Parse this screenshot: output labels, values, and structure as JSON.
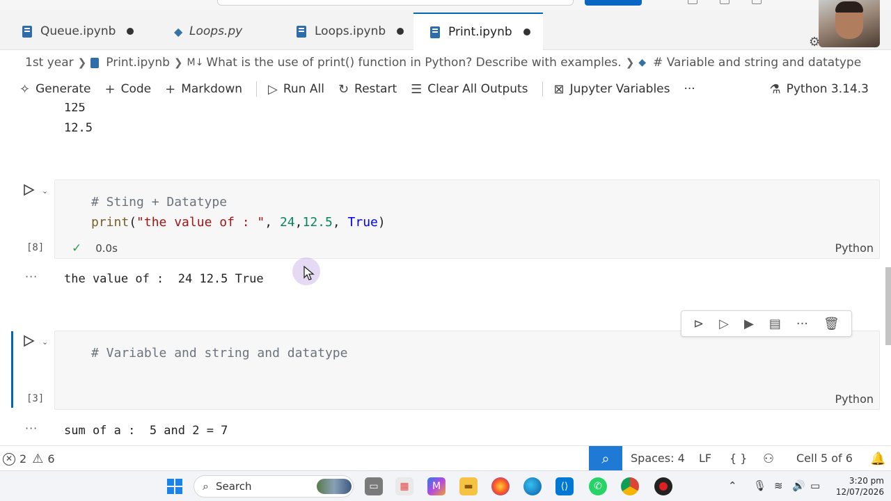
{
  "tabs": [
    {
      "label": "Queue.ipynb",
      "kind": "notebook",
      "modified": true,
      "italic": false,
      "active": false
    },
    {
      "label": "Loops.py",
      "kind": "python",
      "modified": false,
      "italic": true,
      "active": false
    },
    {
      "label": "Loops.ipynb",
      "kind": "notebook",
      "modified": true,
      "italic": false,
      "active": false
    },
    {
      "label": "Print.ipynb",
      "kind": "notebook",
      "modified": true,
      "italic": false,
      "active": true
    }
  ],
  "breadcrumb": {
    "items": [
      "1st year",
      "Print.ipynb",
      "What is the use of print() function in Python? Describe with examples.",
      "# Variable and string and datatype"
    ],
    "md_badge": "M↓"
  },
  "toolbar": {
    "generate": "Generate",
    "code": "Code",
    "markdown": "Markdown",
    "run_all": "Run All",
    "restart": "Restart",
    "clear_outputs": "Clear All Outputs",
    "variables": "Jupyter Variables",
    "more": "···",
    "kernel": "Python 3.14.3"
  },
  "notebook": {
    "prev_output": [
      "125",
      "12.5"
    ],
    "cell1": {
      "comment": "# Sting + Datatype",
      "func": "print",
      "open": "(",
      "str": "\"the value of : \"",
      "sep1": ", ",
      "num1": "24",
      "sep2": ",",
      "num2": "12.5",
      "sep3": ", ",
      "kw": "True",
      "close": ")",
      "exec_count": "[8]",
      "duration": "0.0s",
      "lang": "Python",
      "output": "the value of :  24 12.5 True"
    },
    "cell2": {
      "comment": "# Variable and string and datatype",
      "exec_count": "[3]",
      "lang": "Python",
      "output": "sum of a :  5 and 2 = 7"
    },
    "output_dots": "···"
  },
  "statusbar": {
    "errors": "2",
    "warnings": "6",
    "spaces": "Spaces: 4",
    "eol": "LF",
    "braces": "{ }",
    "cell": "Cell 5 of 6"
  },
  "taskbar": {
    "search": "Search",
    "time": "3:20 pm",
    "date": "12/07/2026"
  }
}
